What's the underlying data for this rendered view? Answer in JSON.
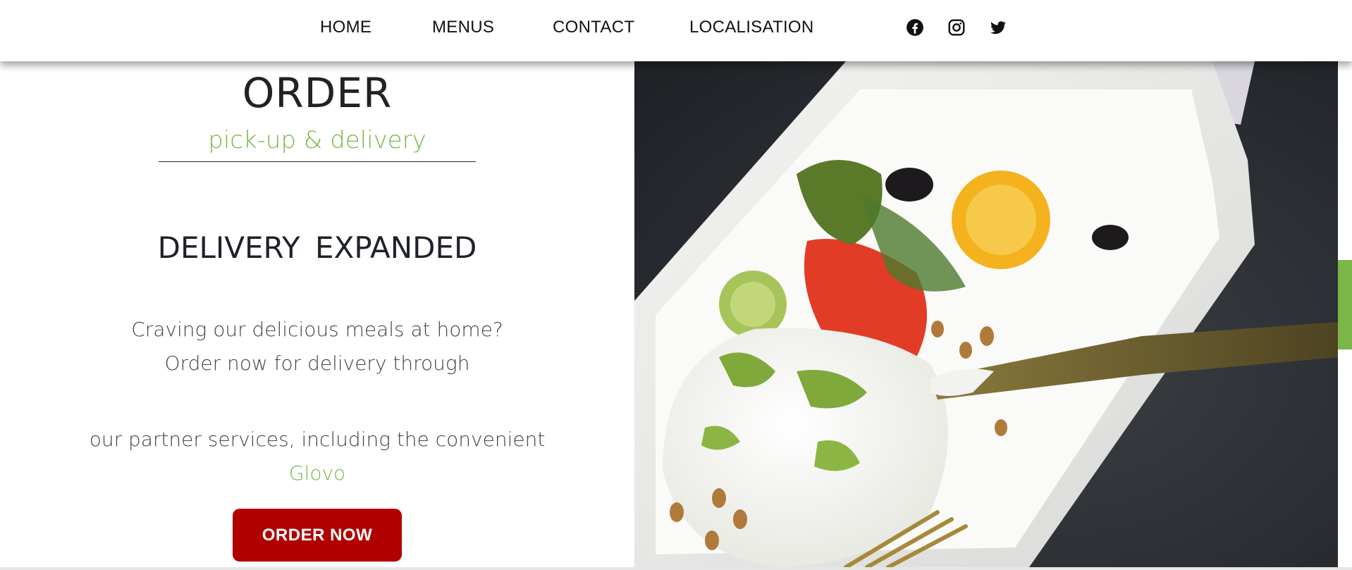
{
  "nav": {
    "links": [
      "HOME",
      "MENUS",
      "CONTACT",
      "LOCALISATION"
    ],
    "social": [
      "facebook-icon",
      "instagram-icon",
      "twitter-icon"
    ]
  },
  "order": {
    "title": "ORDER",
    "subtitle": "pick-up & delivery",
    "heading": "DELIVERY  EXPANDED",
    "line1": "Craving our delicious meals at home?",
    "line2": "Order now for delivery through",
    "line3": "our partner services, including the convenient",
    "partner": "Glovo",
    "button": "ORDER NOW"
  },
  "colors": {
    "accent_green": "#7ab648",
    "button_red": "#b00000",
    "text_dark": "#222222"
  }
}
